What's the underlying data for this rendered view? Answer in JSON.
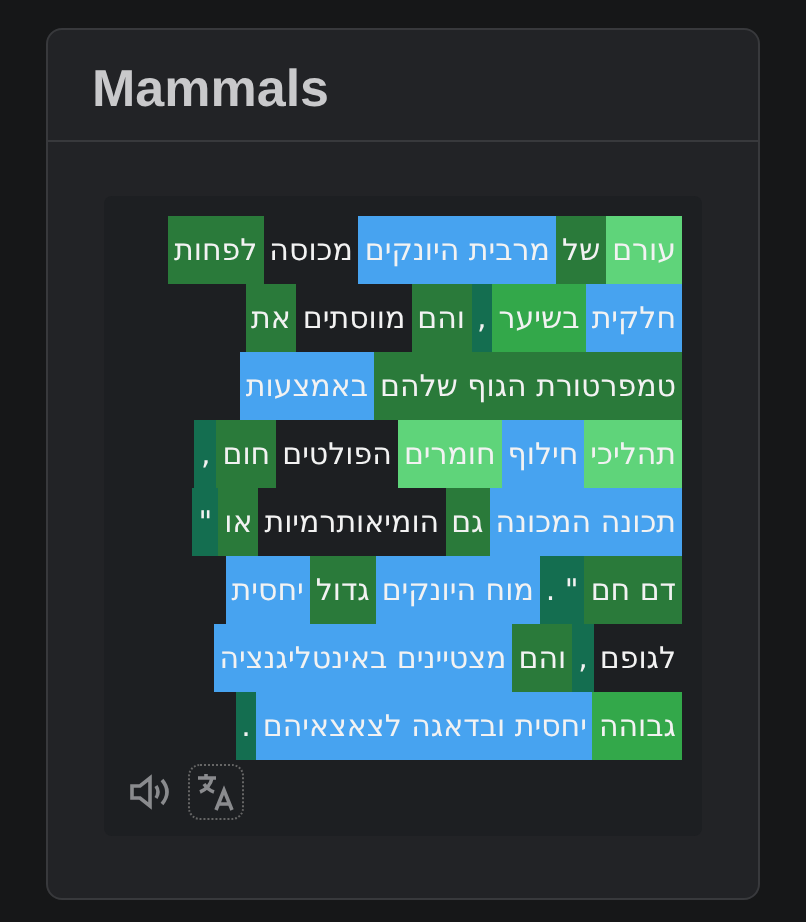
{
  "card": {
    "title": "Mammals"
  },
  "lines": [
    [
      {
        "text": "עורם",
        "color": "#5fd47a"
      },
      {
        "text": "של",
        "color": "#2a7a3a"
      },
      {
        "text": "מרבית היונקים",
        "color": "#47a3f0"
      },
      {
        "text": "מכוסה",
        "color": "#1d1f22"
      },
      {
        "text": "לפחות",
        "color": "#2a7a3a"
      }
    ],
    [
      {
        "text": "חלקית",
        "color": "#47a3f0"
      },
      {
        "text": "בשיער",
        "color": "#33a84a"
      },
      {
        "text": ",",
        "color": "#146e50"
      },
      {
        "text": "והם",
        "color": "#2a7a3a"
      },
      {
        "text": "מווסתים",
        "color": "#1d1f22"
      },
      {
        "text": "את",
        "color": "#2a7a3a"
      }
    ],
    [
      {
        "text": "טמפרטורת הגוף שלהם",
        "color": "#2a7a3a"
      },
      {
        "text": "באמצעות",
        "color": "#47a3f0"
      }
    ],
    [
      {
        "text": "תהליכי",
        "color": "#5fd47a"
      },
      {
        "text": "חילוף",
        "color": "#47a3f0"
      },
      {
        "text": "חומרים",
        "color": "#5fd47a"
      },
      {
        "text": "הפולטים",
        "color": "#1d1f22"
      },
      {
        "text": "חום",
        "color": "#2a7a3a"
      },
      {
        "text": ",",
        "color": "#146e50"
      }
    ],
    [
      {
        "text": "תכונה המכונה",
        "color": "#47a3f0"
      },
      {
        "text": "גם",
        "color": "#2a7a3a"
      },
      {
        "text": "הומיאותרמיות",
        "color": "#1d1f22"
      },
      {
        "text": "או",
        "color": "#2a7a3a"
      },
      {
        "text": "\"",
        "color": "#146e50"
      }
    ],
    [
      {
        "text": "דם חם",
        "color": "#2a7a3a"
      },
      {
        "text": "\" .",
        "color": "#146e50"
      },
      {
        "text": "מוח היונקים",
        "color": "#47a3f0"
      },
      {
        "text": "גדול",
        "color": "#2a7a3a"
      },
      {
        "text": "יחסית",
        "color": "#47a3f0"
      }
    ],
    [
      {
        "text": "לגופם",
        "color": "#1d1f22"
      },
      {
        "text": ",",
        "color": "#146e50"
      },
      {
        "text": "והם",
        "color": "#2a7a3a"
      },
      {
        "text": "מצטיינים באינטליגנציה",
        "color": "#47a3f0"
      }
    ],
    [
      {
        "text": "גבוהה",
        "color": "#33a84a"
      },
      {
        "text": "יחסית ובדאגה לצאצאיהם",
        "color": "#47a3f0"
      },
      {
        "text": ".",
        "color": "#146e50"
      }
    ]
  ]
}
